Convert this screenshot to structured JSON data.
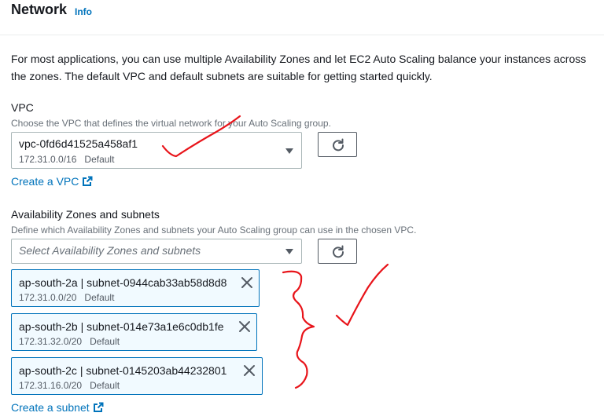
{
  "section": {
    "title": "Network",
    "info_label": "Info"
  },
  "intro_text": "For most applications, you can use multiple Availability Zones and let EC2 Auto Scaling balance your instances across the zones. The default VPC and default subnets are suitable for getting started quickly.",
  "vpc": {
    "label": "VPC",
    "description": "Choose the VPC that defines the virtual network for your Auto Scaling group.",
    "selected_value": "vpc-0fd6d41525a458af1",
    "selected_cidr": "172.31.0.0/16",
    "selected_tag": "Default",
    "create_link": "Create a VPC"
  },
  "subnets": {
    "label": "Availability Zones and subnets",
    "description": "Define which Availability Zones and subnets your Auto Scaling group can use in the chosen VPC.",
    "placeholder": "Select Availability Zones and subnets",
    "tokens": [
      {
        "value": "ap-south-2a | subnet-0944cab33ab58d8d8",
        "cidr": "172.31.0.0/20",
        "tag": "Default"
      },
      {
        "value": "ap-south-2b | subnet-014e73a1e6c0db1fe",
        "cidr": "172.31.32.0/20",
        "tag": "Default"
      },
      {
        "value": "ap-south-2c | subnet-0145203ab44232801",
        "cidr": "172.31.16.0/20",
        "tag": "Default"
      }
    ],
    "create_link": "Create a subnet"
  },
  "icons": {
    "refresh": "refresh-icon",
    "dropdown": "caret-down-icon",
    "external": "external-link-icon",
    "dismiss": "close-icon"
  },
  "colors": {
    "link": "#0073bb",
    "token_border": "#0073bb",
    "token_bg": "#f1faff",
    "annotation": "#e8141a"
  }
}
